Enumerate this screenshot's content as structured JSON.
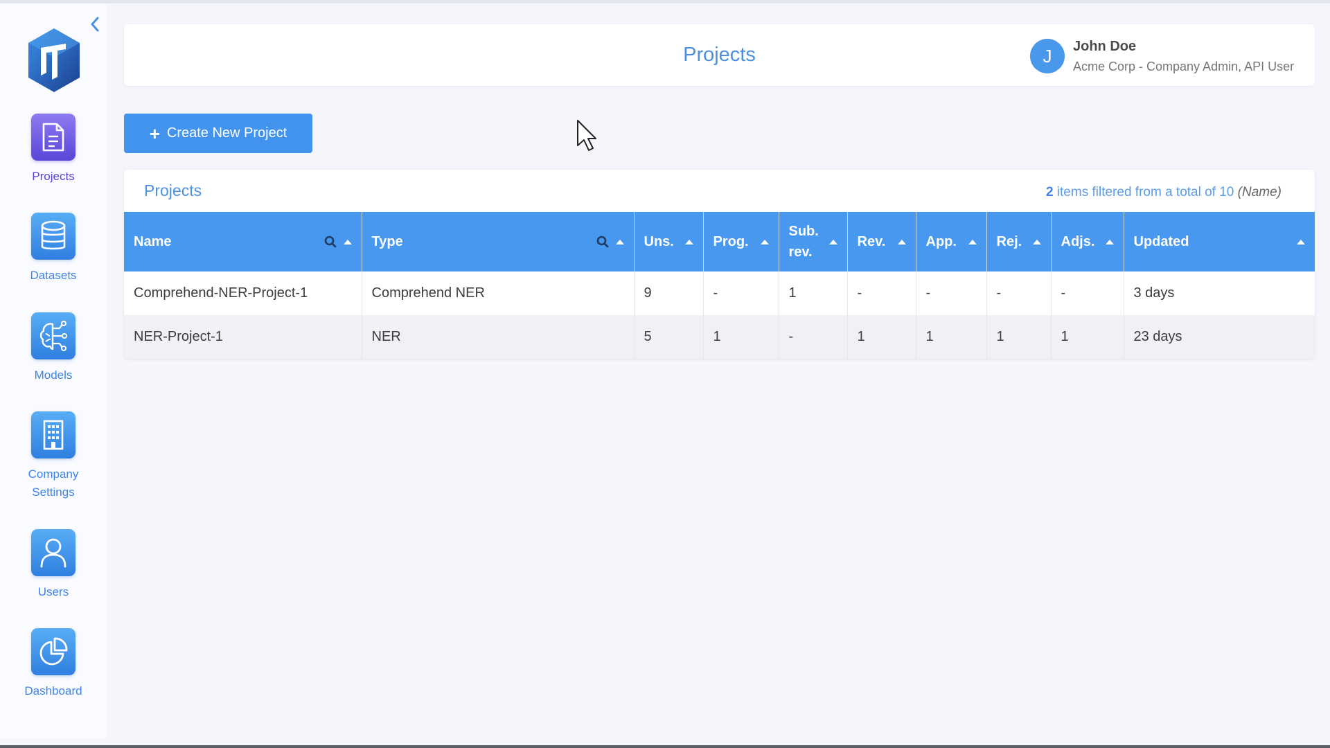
{
  "sidebar": {
    "items": [
      {
        "label": "Projects",
        "icon": "document-icon",
        "active": true
      },
      {
        "label": "Datasets",
        "icon": "database-icon"
      },
      {
        "label": "Models",
        "icon": "brain-circuit-icon"
      },
      {
        "label": "Company Settings",
        "icon": "building-icon"
      },
      {
        "label": "Users",
        "icon": "user-icon"
      },
      {
        "label": "Dashboard",
        "icon": "pie-chart-icon"
      }
    ]
  },
  "header": {
    "title": "Projects",
    "user": {
      "initial": "J",
      "name": "John Doe",
      "role": "Acme Corp - Company Admin, API User"
    }
  },
  "actions": {
    "create_label": "Create New Project"
  },
  "projects_table": {
    "title": "Projects",
    "filter_count": "2",
    "filter_text": " items filtered from a total of 10 ",
    "filter_field": "(Name)",
    "columns": [
      "Name",
      "Type",
      "Uns.",
      "Prog.",
      "Sub. rev.",
      "Rev.",
      "App.",
      "Rej.",
      "Adjs.",
      "Updated"
    ],
    "rows": [
      [
        "Comprehend-NER-Project-1",
        "Comprehend NER",
        "9",
        "-",
        "1",
        "-",
        "-",
        "-",
        "-",
        "3 days"
      ],
      [
        "NER-Project-1",
        "NER",
        "5",
        "1",
        "-",
        "1",
        "1",
        "1",
        "1",
        "23 days"
      ]
    ]
  },
  "colors": {
    "accent": "#4293ee",
    "header_bg": "#4798ee",
    "active_nav": "#5a45d8"
  }
}
